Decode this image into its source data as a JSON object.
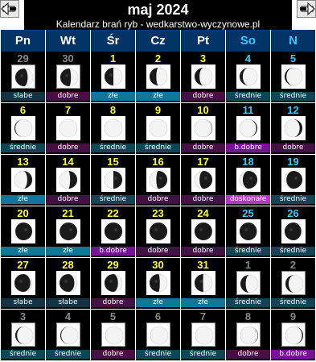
{
  "calendar": {
    "title": "maj 2024",
    "subtitle": "Kalendarz brań ryb - wedkarstwo-wyczynowe.pl",
    "weekdays": [
      "Pn",
      "Wt",
      "Śr",
      "Cz",
      "Pt",
      "So",
      "N"
    ],
    "rating_colors": {
      "słabe": "#113344",
      "dobre": "#441144",
      "złe": "#117799",
      "średnie": "#114455",
      "b.dobre": "#771199",
      "doskonałe": "#bb33cc"
    },
    "days": [
      {
        "day": "29",
        "month": "prev",
        "rating": "słabe",
        "illum": 0.7,
        "waxing": false
      },
      {
        "day": "30",
        "month": "prev",
        "rating": "dobre",
        "illum": 0.6,
        "waxing": false
      },
      {
        "day": "1",
        "month": "cur",
        "rating": "złe",
        "illum": 0.5,
        "waxing": false
      },
      {
        "day": "2",
        "month": "cur",
        "rating": "złe",
        "illum": 0.38,
        "waxing": false
      },
      {
        "day": "3",
        "month": "cur",
        "rating": "dobre",
        "illum": 0.28,
        "waxing": false
      },
      {
        "day": "4",
        "month": "cur",
        "rating": "średnie",
        "illum": 0.18,
        "waxing": false
      },
      {
        "day": "5",
        "month": "cur",
        "rating": "średnie",
        "illum": 0.1,
        "waxing": false
      },
      {
        "day": "6",
        "month": "cur",
        "rating": "średnie",
        "illum": 0.05,
        "waxing": false
      },
      {
        "day": "7",
        "month": "cur",
        "rating": "dobre",
        "illum": 0.0,
        "waxing": false
      },
      {
        "day": "8",
        "month": "cur",
        "rating": "średnie",
        "illum": 0.0,
        "waxing": false
      },
      {
        "day": "9",
        "month": "cur",
        "rating": "średnie",
        "illum": 0.0,
        "waxing": false
      },
      {
        "day": "10",
        "month": "cur",
        "rating": "dobre",
        "illum": 0.02,
        "waxing": true
      },
      {
        "day": "11",
        "month": "cur",
        "rating": "b.dobre",
        "illum": 0.06,
        "waxing": true
      },
      {
        "day": "12",
        "month": "cur",
        "rating": "dobre",
        "illum": 0.15,
        "waxing": true
      },
      {
        "day": "13",
        "month": "cur",
        "rating": "złe",
        "illum": 0.28,
        "waxing": true
      },
      {
        "day": "14",
        "month": "cur",
        "rating": "dobre",
        "illum": 0.4,
        "waxing": true
      },
      {
        "day": "15",
        "month": "cur",
        "rating": "średnie",
        "illum": 0.5,
        "waxing": true
      },
      {
        "day": "16",
        "month": "cur",
        "rating": "dobre",
        "illum": 0.62,
        "waxing": true
      },
      {
        "day": "17",
        "month": "cur",
        "rating": "dobre",
        "illum": 0.72,
        "waxing": true
      },
      {
        "day": "18",
        "month": "cur",
        "rating": "doskonałe",
        "illum": 0.82,
        "waxing": true
      },
      {
        "day": "19",
        "month": "cur",
        "rating": "średnie",
        "illum": 0.9,
        "waxing": true
      },
      {
        "day": "20",
        "month": "cur",
        "rating": "złe",
        "illum": 0.95,
        "waxing": true
      },
      {
        "day": "21",
        "month": "cur",
        "rating": "złe",
        "illum": 0.99,
        "waxing": true
      },
      {
        "day": "22",
        "month": "cur",
        "rating": "b.dobre",
        "illum": 1.0,
        "waxing": true
      },
      {
        "day": "23",
        "month": "cur",
        "rating": "dobre",
        "illum": 1.0,
        "waxing": false
      },
      {
        "day": "24",
        "month": "cur",
        "rating": "dobre",
        "illum": 0.99,
        "waxing": false
      },
      {
        "day": "25",
        "month": "cur",
        "rating": "średnie",
        "illum": 0.97,
        "waxing": false
      },
      {
        "day": "26",
        "month": "cur",
        "rating": "średnie",
        "illum": 0.94,
        "waxing": false
      },
      {
        "day": "27",
        "month": "cur",
        "rating": "słabe",
        "illum": 0.9,
        "waxing": false
      },
      {
        "day": "28",
        "month": "cur",
        "rating": "słabe",
        "illum": 0.84,
        "waxing": false
      },
      {
        "day": "29",
        "month": "cur",
        "rating": "dobre",
        "illum": 0.76,
        "waxing": false
      },
      {
        "day": "30",
        "month": "cur",
        "rating": "złe",
        "illum": 0.58,
        "waxing": false
      },
      {
        "day": "31",
        "month": "cur",
        "rating": "złe",
        "illum": 0.48,
        "waxing": false
      },
      {
        "day": "1",
        "month": "next",
        "rating": "średnie",
        "illum": 0.3,
        "waxing": false
      },
      {
        "day": "2",
        "month": "next",
        "rating": "średnie",
        "illum": 0.18,
        "waxing": false
      },
      {
        "day": "3",
        "month": "next",
        "rating": "średnie",
        "illum": 0.1,
        "waxing": false
      },
      {
        "day": "4",
        "month": "next",
        "rating": "średnie",
        "illum": 0.05,
        "waxing": false
      },
      {
        "day": "5",
        "month": "next",
        "rating": "dobre",
        "illum": 0.0,
        "waxing": false
      },
      {
        "day": "6",
        "month": "next",
        "rating": "średnie",
        "illum": 0.0,
        "waxing": false
      },
      {
        "day": "7",
        "month": "next",
        "rating": "średnie",
        "illum": 0.0,
        "waxing": false
      },
      {
        "day": "8",
        "month": "next",
        "rating": "dobre",
        "illum": 0.02,
        "waxing": true
      },
      {
        "day": "9",
        "month": "next",
        "rating": "b.dobre",
        "illum": 0.06,
        "waxing": true
      }
    ]
  }
}
